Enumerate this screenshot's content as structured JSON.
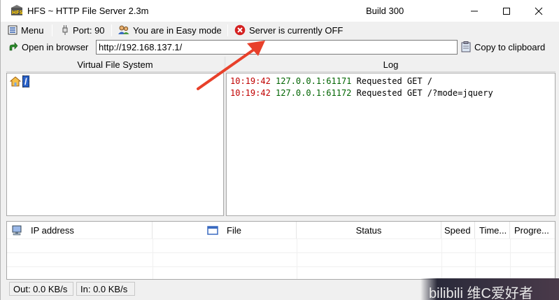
{
  "window": {
    "title": "HFS ~ HTTP File Server 2.3m",
    "build": "Build 300"
  },
  "toolbar": {
    "menu_label": "Menu",
    "port_label": "Port: 90",
    "mode_label": "You are in Easy mode",
    "server_status": "Server is currently OFF"
  },
  "urlbar": {
    "open_label": "Open in browser",
    "url_value": "http://192.168.137.1/",
    "copy_label": "Copy to clipboard"
  },
  "vfs": {
    "header": "Virtual File System",
    "root_label": "/"
  },
  "log": {
    "header": "Log",
    "entries": [
      {
        "time": "10:19:42",
        "address": "127.0.0.1:61171",
        "message": "Requested GET /"
      },
      {
        "time": "10:19:42",
        "address": "127.0.0.1:61172",
        "message": "Requested GET /?mode=jquery"
      }
    ]
  },
  "connections": {
    "columns": [
      "IP address",
      "File",
      "Status",
      "Speed",
      "Time...",
      "Progre..."
    ]
  },
  "statusbar": {
    "out_label": "Out: 0.0 KB/s",
    "in_label": "In: 0.0 KB/s"
  },
  "overlay": {
    "watermark_text": "bilibili 维C爱好者"
  },
  "colors": {
    "log_time": "#c00000",
    "log_address": "#006400",
    "arrow": "#e8402a",
    "server_off_icon": "#d42020"
  },
  "icons": [
    "hfs-app-icon",
    "menu-icon",
    "port-plug-icon",
    "users-icon",
    "server-off-icon",
    "open-browser-arrow-icon",
    "clipboard-icon",
    "home-folder-icon",
    "network-computer-icon",
    "file-icon"
  ]
}
